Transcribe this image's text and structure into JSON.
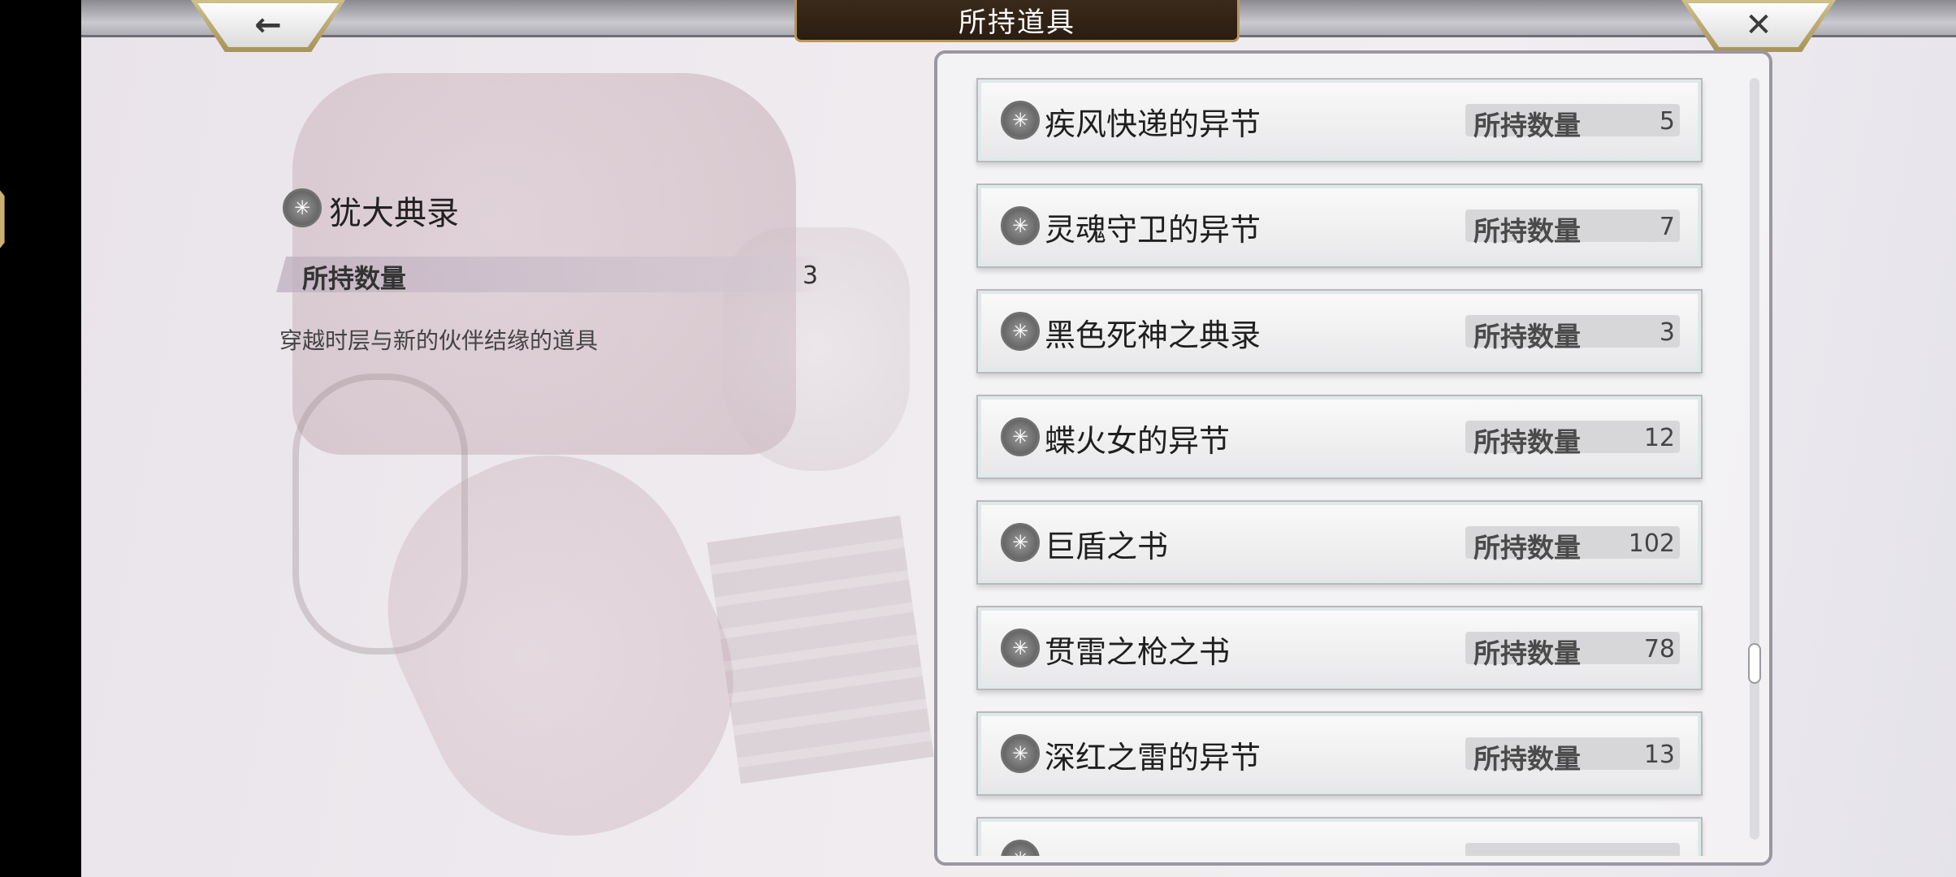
{
  "header": {
    "title": "所持道具",
    "back_icon": "←",
    "close_icon": "✕"
  },
  "detail": {
    "name": "犹大典录",
    "qty_label": "所持数量",
    "qty_value": "3",
    "description": "穿越时层与新的伙伴结缘的道具",
    "icon_glyph": "✳"
  },
  "items": [
    {
      "name": "疾风快递的异节",
      "qty_label": "所持数量",
      "qty": "5"
    },
    {
      "name": "灵魂守卫的异节",
      "qty_label": "所持数量",
      "qty": "7"
    },
    {
      "name": "黑色死神之典录",
      "qty_label": "所持数量",
      "qty": "3"
    },
    {
      "name": "蝶火女的异节",
      "qty_label": "所持数量",
      "qty": "12"
    },
    {
      "name": "巨盾之书",
      "qty_label": "所持数量",
      "qty": "102"
    },
    {
      "name": "贯雷之枪之书",
      "qty_label": "所持数量",
      "qty": "78"
    },
    {
      "name": "深红之雷的异节",
      "qty_label": "所持数量",
      "qty": "13"
    },
    {
      "name": "",
      "qty_label": "",
      "qty": ""
    }
  ],
  "scroll_position": 0.78,
  "colors": {
    "title_plate": "#2a1d12",
    "gold_trim": "#b8975a"
  }
}
